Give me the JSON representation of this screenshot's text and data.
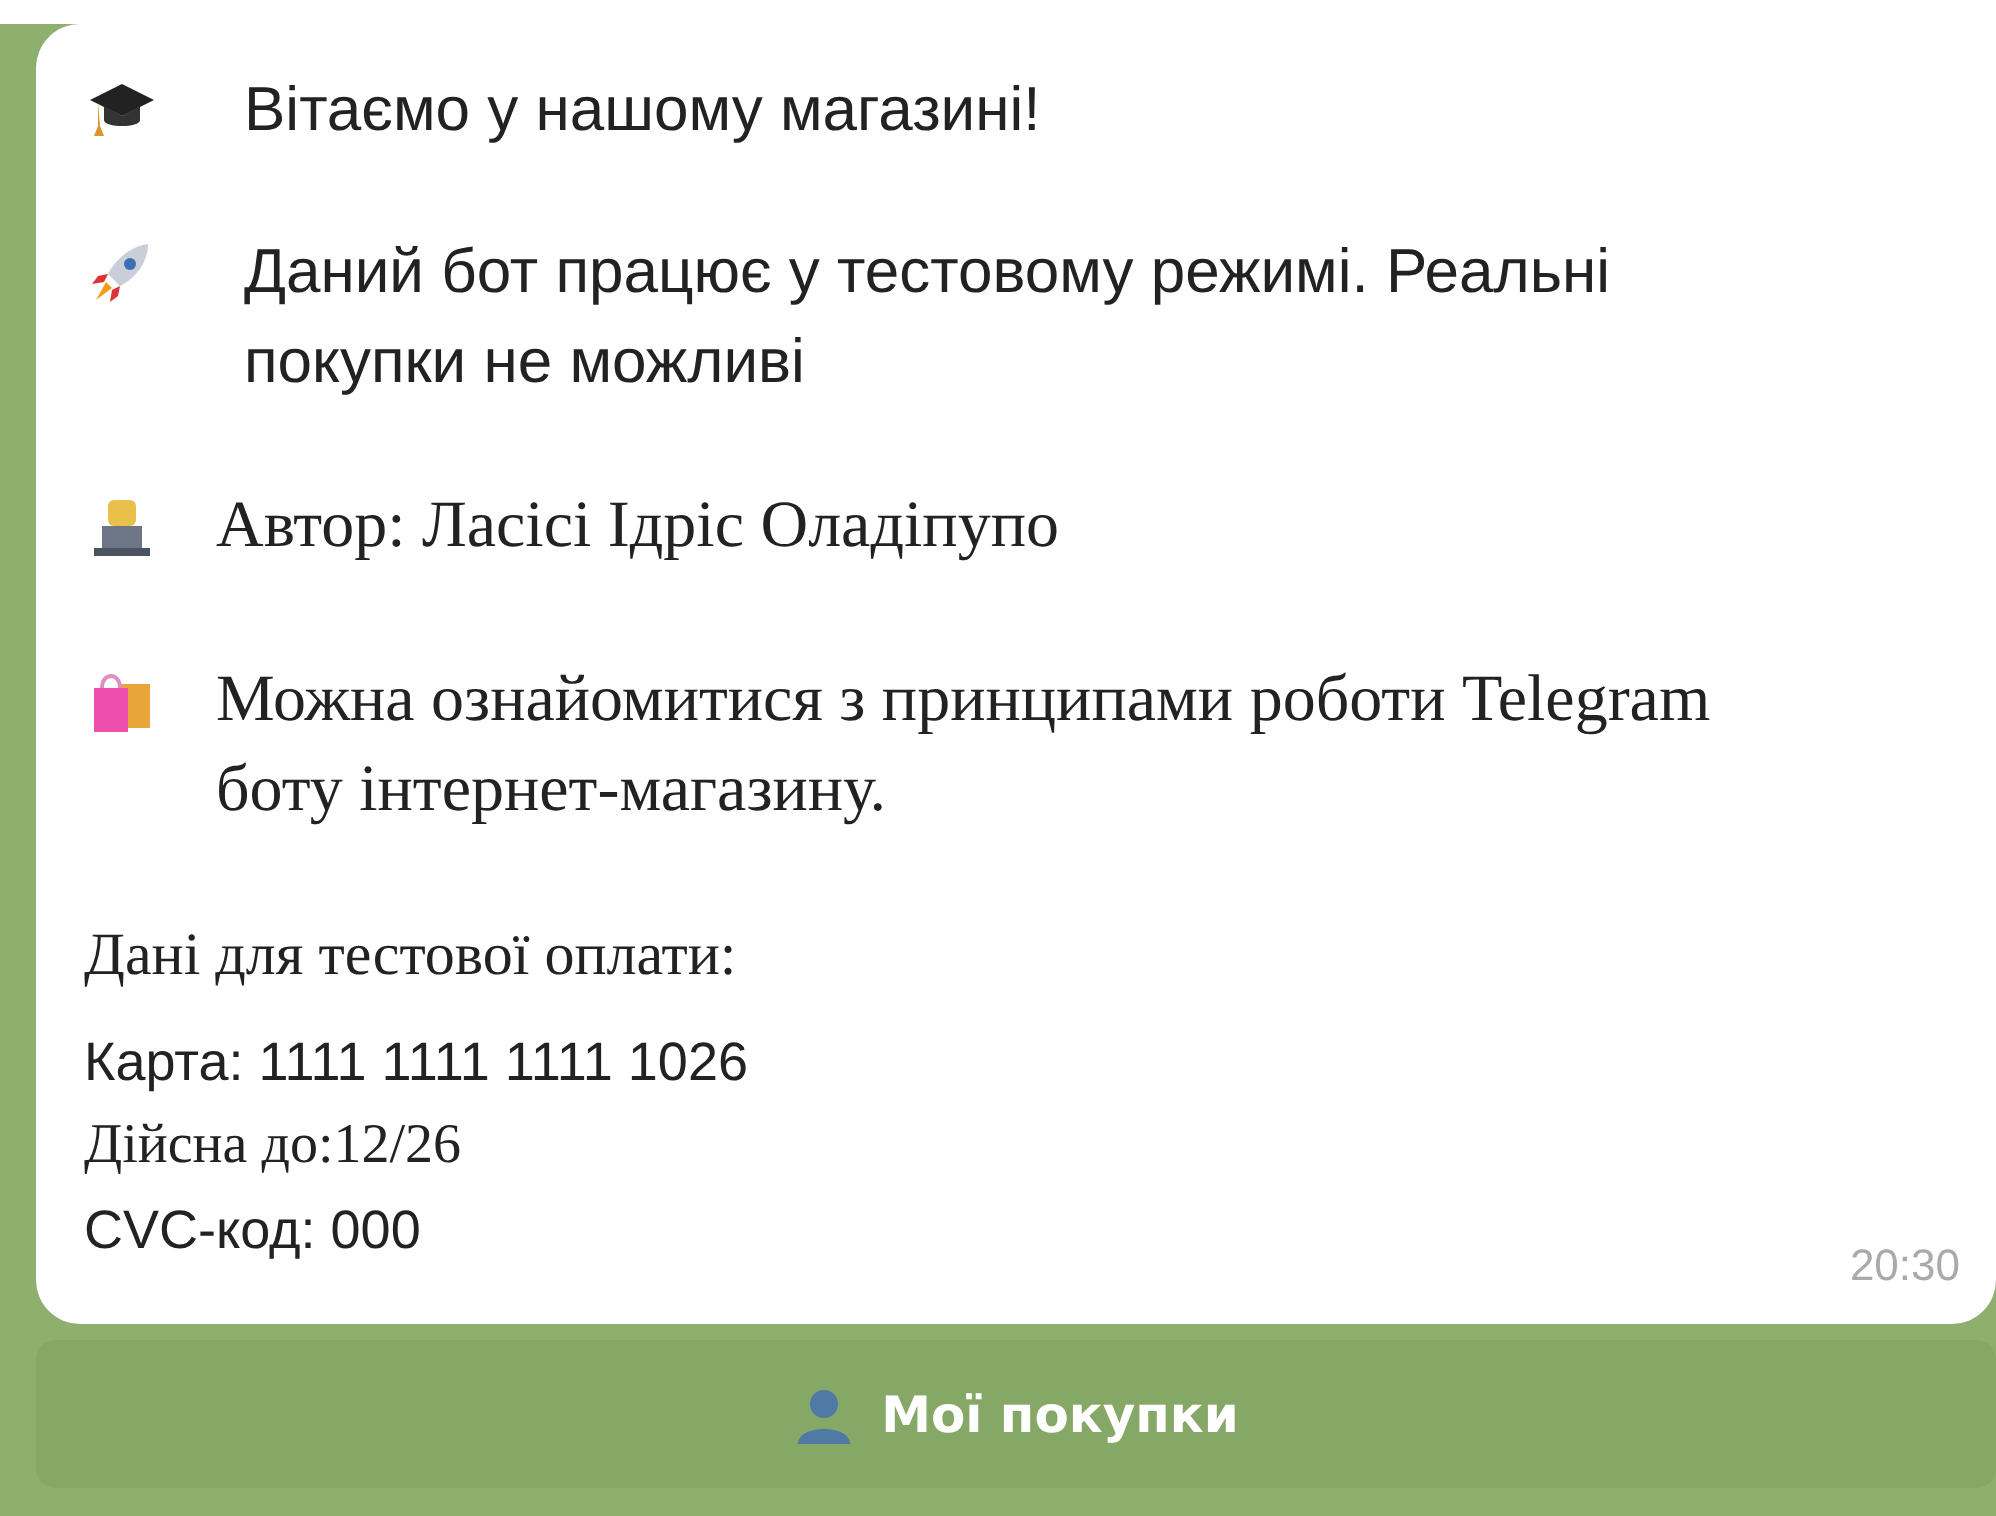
{
  "message": {
    "paragraphs": [
      {
        "kind": "graduation-cap",
        "text": "Вітаємо у нашому магазині!"
      },
      {
        "kind": "rocket",
        "text": "Даний бот працює у тестовому режимі. Реальні покупки не можливі"
      },
      {
        "kind": "author",
        "text": "Автор: Ласісі Ідріс Оладіпупо"
      },
      {
        "kind": "shopping",
        "text": "Можна ознайомитися з принципами роботи Telegram боту інтернет-магазину."
      }
    ],
    "payment_heading": "Дані для тестової оплати:",
    "payment_lines": [
      "Карта: 1111 1111 1111 1026",
      "Дійсна до:12/26",
      "CVC-код: 000"
    ],
    "time": "20:30"
  },
  "keyboard": [
    {
      "label": "Мої покупки",
      "kind": "profile"
    }
  ]
}
